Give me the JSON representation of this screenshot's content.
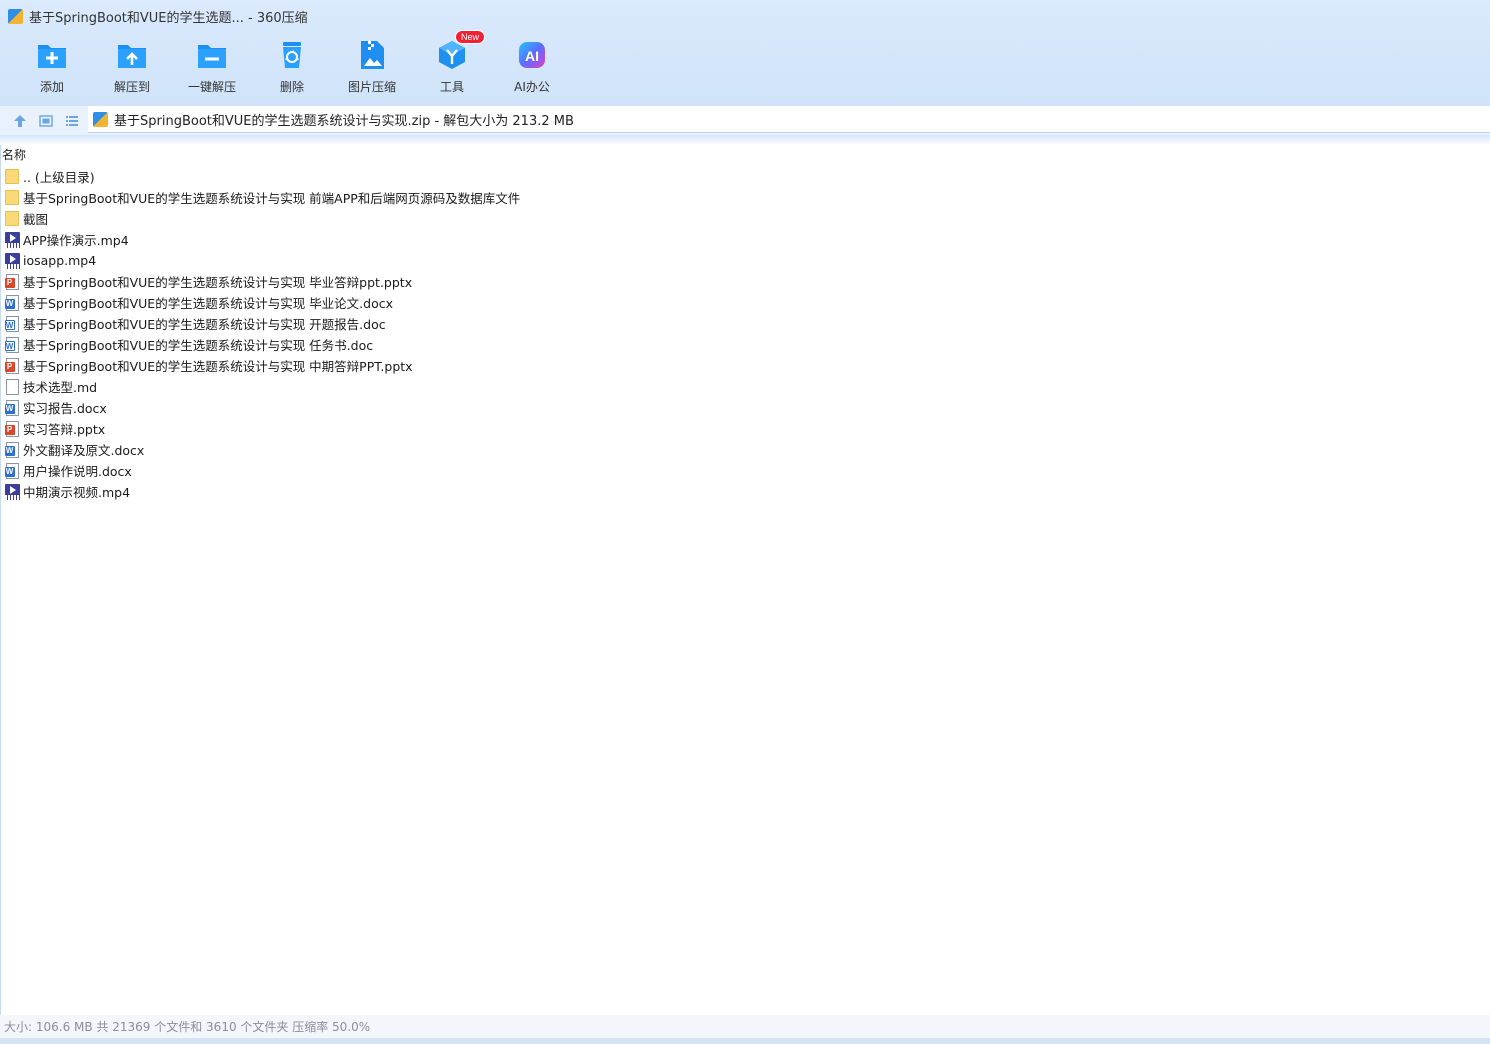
{
  "window": {
    "title": "基于SpringBoot和VUE的学生选题... - 360压缩"
  },
  "toolbar": {
    "items": [
      {
        "label": "添加",
        "icon": "add-folder-icon"
      },
      {
        "label": "解压到",
        "icon": "extract-to-icon"
      },
      {
        "label": "一键解压",
        "icon": "one-click-extract-icon"
      },
      {
        "label": "删除",
        "icon": "recycle-delete-icon"
      },
      {
        "label": "图片压缩",
        "icon": "image-compress-icon"
      },
      {
        "label": "工具",
        "icon": "tools-icon",
        "badge": "New"
      },
      {
        "label": "AI办公",
        "icon": "ai-office-icon",
        "icon_text": "AI"
      }
    ]
  },
  "path": {
    "text": "基于SpringBoot和VUE的学生选题系统设计与实现.zip - 解包大小为 213.2 MB"
  },
  "columns": {
    "name": "名称"
  },
  "files": [
    {
      "name": ".. (上级目录)",
      "type": "folder"
    },
    {
      "name": "基于SpringBoot和VUE的学生选题系统设计与实现 前端APP和后端网页源码及数据库文件",
      "type": "folder"
    },
    {
      "name": "截图",
      "type": "folder"
    },
    {
      "name": "APP操作演示.mp4",
      "type": "video"
    },
    {
      "name": "iosapp.mp4",
      "type": "video"
    },
    {
      "name": "基于SpringBoot和VUE的学生选题系统设计与实现 毕业答辩ppt.pptx",
      "type": "pptx"
    },
    {
      "name": "基于SpringBoot和VUE的学生选题系统设计与实现 毕业论文.docx",
      "type": "docx"
    },
    {
      "name": "基于SpringBoot和VUE的学生选题系统设计与实现 开题报告.doc",
      "type": "doc"
    },
    {
      "name": "基于SpringBoot和VUE的学生选题系统设计与实现 任务书.doc",
      "type": "doc"
    },
    {
      "name": "基于SpringBoot和VUE的学生选题系统设计与实现 中期答辩PPT.pptx",
      "type": "pptx"
    },
    {
      "name": "技术选型.md",
      "type": "md"
    },
    {
      "name": "实习报告.docx",
      "type": "docx"
    },
    {
      "name": "实习答辩.pptx",
      "type": "pptx"
    },
    {
      "name": "外文翻译及原文.docx",
      "type": "docx"
    },
    {
      "name": "用户操作说明.docx",
      "type": "docx"
    },
    {
      "name": "中期演示视频.mp4",
      "type": "video"
    }
  ],
  "status": {
    "text": "大小: 106.6 MB 共 21369 个文件和 3610 个文件夹 压缩率 50.0%"
  },
  "colors": {
    "folder": "#fbd878",
    "word": "#2b6fd6",
    "ppt": "#d9472b",
    "video": "#3a3f9e",
    "accent": "#1e90f0"
  }
}
